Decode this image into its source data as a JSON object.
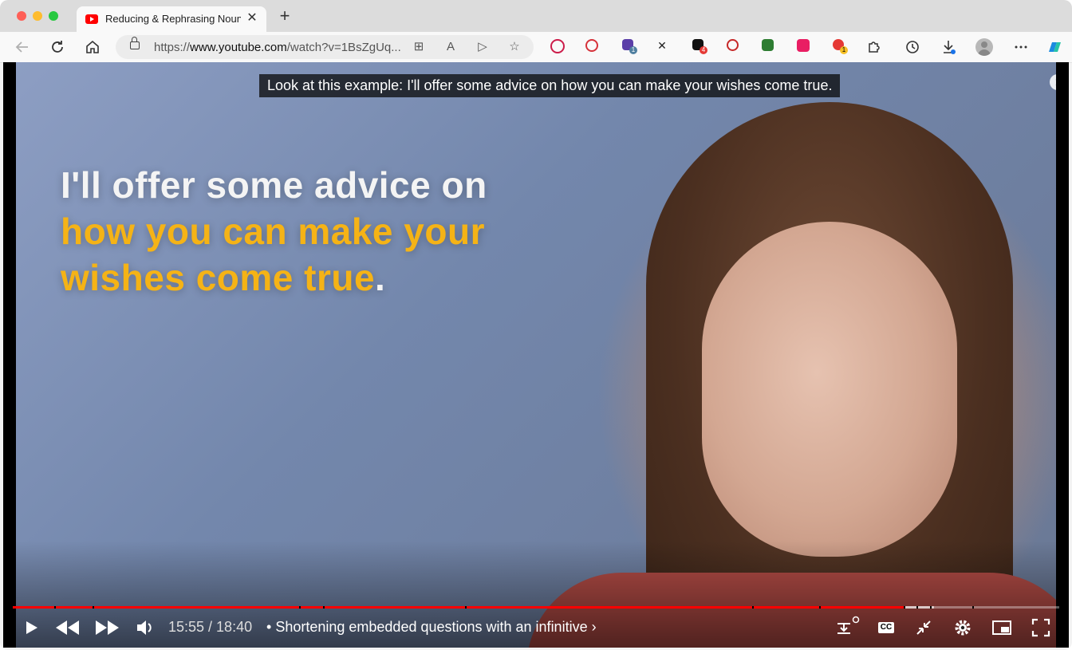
{
  "browser": {
    "tab": {
      "title": "Reducing & Rephrasing Noun C",
      "close": "✕"
    },
    "new_tab": "+",
    "address": {
      "url_prefix": "https://",
      "url_domain": "www.youtube.com",
      "url_path": "/watch?v=1BsZgUq..."
    },
    "extensions": [
      {
        "name": "youtube-ext-icon",
        "color": "#cc1c4a"
      },
      {
        "name": "search-ext-icon",
        "color": "#d6323a"
      },
      {
        "name": "puzzle-ext-icon",
        "color": "#5b3fa8",
        "badge": "1"
      },
      {
        "name": "wand-ext-icon",
        "color": "#222222"
      },
      {
        "name": "chat-ext-icon",
        "color": "#111111",
        "badge": "4"
      },
      {
        "name": "screen-record-ext-icon",
        "color": "#c62828"
      },
      {
        "name": "download-ext-icon",
        "color": "#2e7d32"
      },
      {
        "name": "trello-ext-icon",
        "color": "#e91e63"
      },
      {
        "name": "record-ext-icon",
        "color": "#e53935",
        "badge": "1"
      }
    ]
  },
  "video": {
    "caption": "Look at this example: I'll offer some advice on how you can make your wishes come true.",
    "overlay_line1": "I'll offer some advice on",
    "overlay_line2": "how you can make your",
    "overlay_line3": "wishes come true",
    "overlay_period": ".",
    "info": "i"
  },
  "controls": {
    "current_time": "15:55",
    "duration": "18:40",
    "time_display": "15:55 / 18:40",
    "chapter": "Shortening embedded questions with an infinitive",
    "chapter_separator": "•",
    "chapter_arrow": "›",
    "progress_fraction": 0.853,
    "buffer_fraction": 0.88,
    "cc_label": "CC"
  },
  "colors": {
    "progress": "#ff0000",
    "overlay_yellow": "#f5b316"
  }
}
